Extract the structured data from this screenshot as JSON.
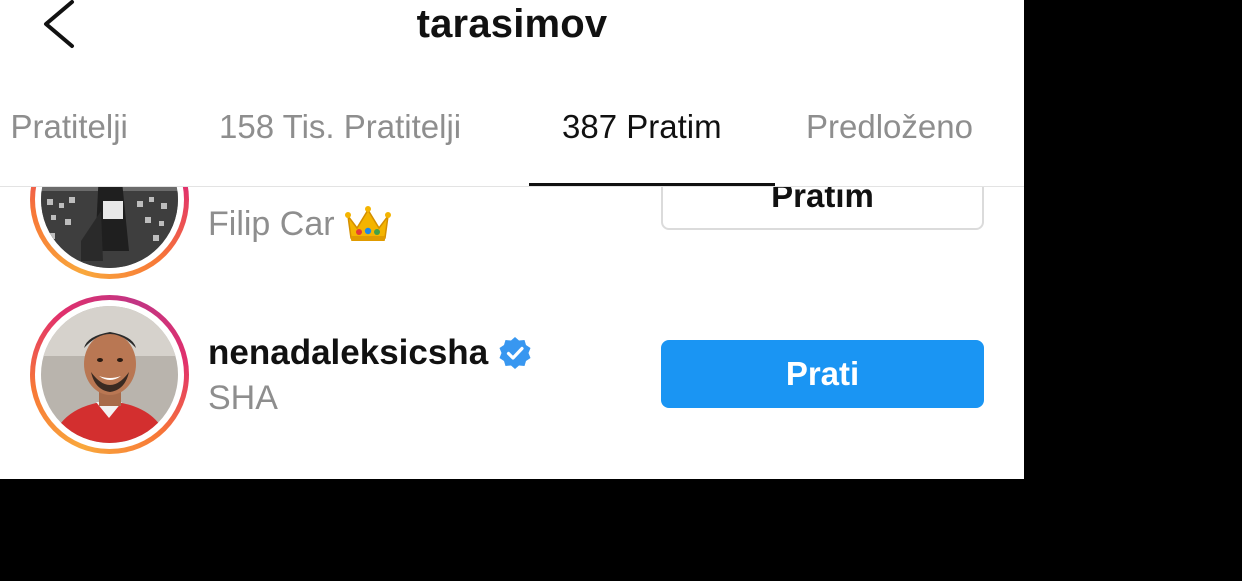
{
  "header": {
    "title": "tarasimov",
    "back_icon": "chevron-left-icon"
  },
  "tabs": [
    {
      "label": "i Pratitelji",
      "active": false
    },
    {
      "label": "158 Tis. Pratitelji",
      "active": false
    },
    {
      "label": "387 Pratim",
      "active": true
    },
    {
      "label": "Predloženo",
      "active": false
    }
  ],
  "list": [
    {
      "username": "",
      "full_name": "Filip Car",
      "emoji": "crown-icon",
      "verified": false,
      "button_label": "Pratim",
      "button_style": "following"
    },
    {
      "username": "nenadaleksicsha",
      "full_name": "SHA",
      "verified": true,
      "button_label": "Prati",
      "button_style": "follow"
    }
  ],
  "colors": {
    "accent_blue": "#1a95f3",
    "verified_blue": "#3897f0",
    "secondary_text": "#8e8e8e",
    "primary_text": "#111111"
  }
}
